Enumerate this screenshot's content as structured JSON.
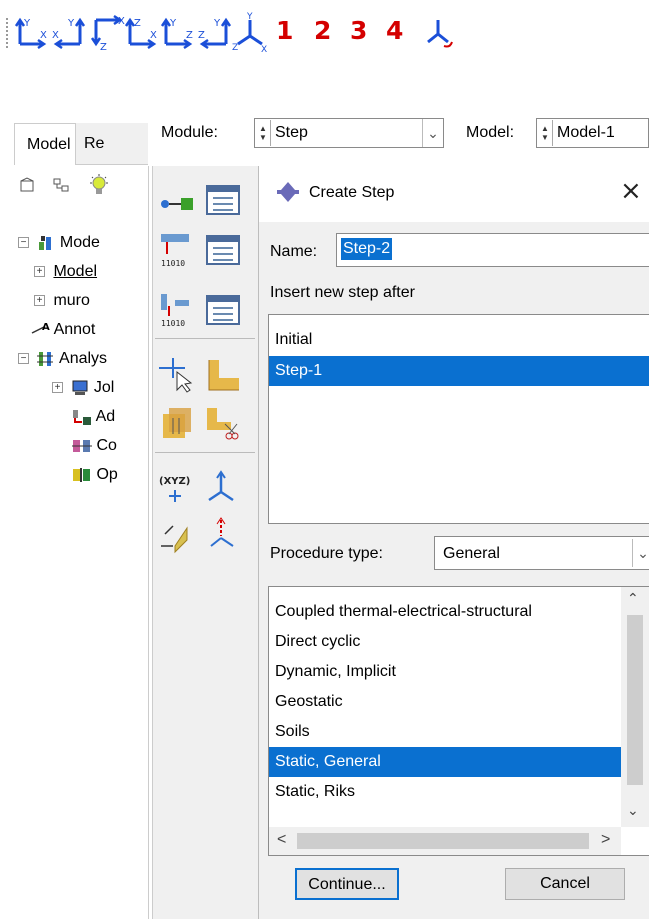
{
  "toolbar": {
    "view_buttons": [
      {
        "icon": "view-xy-axes-icon",
        "axis_a": "Y",
        "axis_b": "X"
      },
      {
        "icon": "view-yx-axes-icon",
        "axis_a": "Y",
        "axis_b": "X"
      },
      {
        "icon": "view-zx-axes-icon",
        "axis_a": "X",
        "axis_b": "Z"
      },
      {
        "icon": "view-zx2-axes-icon",
        "axis_a": "Z",
        "axis_b": "X"
      },
      {
        "icon": "view-yz-axes-icon",
        "axis_a": "Y",
        "axis_b": "Z"
      },
      {
        "icon": "view-zy-axes-icon",
        "axis_a": "Y",
        "axis_b": "Z"
      },
      {
        "icon": "view-iso-axes-icon",
        "axis_a": "Y",
        "axis_b": "X",
        "axis_c": "Z"
      }
    ],
    "numbers": [
      "1",
      "2",
      "3",
      "4"
    ],
    "last_icon": "user-view-icon"
  },
  "module_bar": {
    "module_label": "Module:",
    "module_value": "Step",
    "model_label": "Model:",
    "model_value": "Model-1"
  },
  "tree": {
    "tabs": [
      "Model",
      "Re"
    ],
    "items": [
      {
        "label": "Mode",
        "icon": "models-icon"
      },
      {
        "label": "Model",
        "icon": "plus-icon"
      },
      {
        "label": "muro",
        "icon": "plus-icon"
      },
      {
        "label": "Annot",
        "icon": "annotations-icon"
      },
      {
        "label": "Analys",
        "icon": "analysis-icon"
      },
      {
        "label": "Jol",
        "icon": "jobs-icon"
      },
      {
        "label": "Ad",
        "icon": "adaptivity-icon"
      },
      {
        "label": "Co",
        "icon": "coexecution-icon"
      },
      {
        "label": "Op",
        "icon": "optimization-icon"
      }
    ]
  },
  "dialog": {
    "title": "Create Step",
    "close": "×",
    "name_label": "Name:",
    "name_value": "Step-2",
    "insert_label": "Insert new step after",
    "steps": [
      "Initial",
      "Step-1"
    ],
    "procedure_label": "Procedure type:",
    "procedure_value": "General",
    "procedures": [
      "Coupled thermal-electrical-structural",
      "Direct cyclic",
      "Dynamic, Implicit",
      "Geostatic",
      "Soils",
      "Static, General",
      "Static, Riks"
    ],
    "selected_procedure": "Static, General",
    "continue_label": "Continue...",
    "cancel_label": "Cancel"
  },
  "colors": {
    "selection": "#0a70d0",
    "toolbar_blue": "#1b4fd8",
    "toolbar_red": "#d40000"
  }
}
